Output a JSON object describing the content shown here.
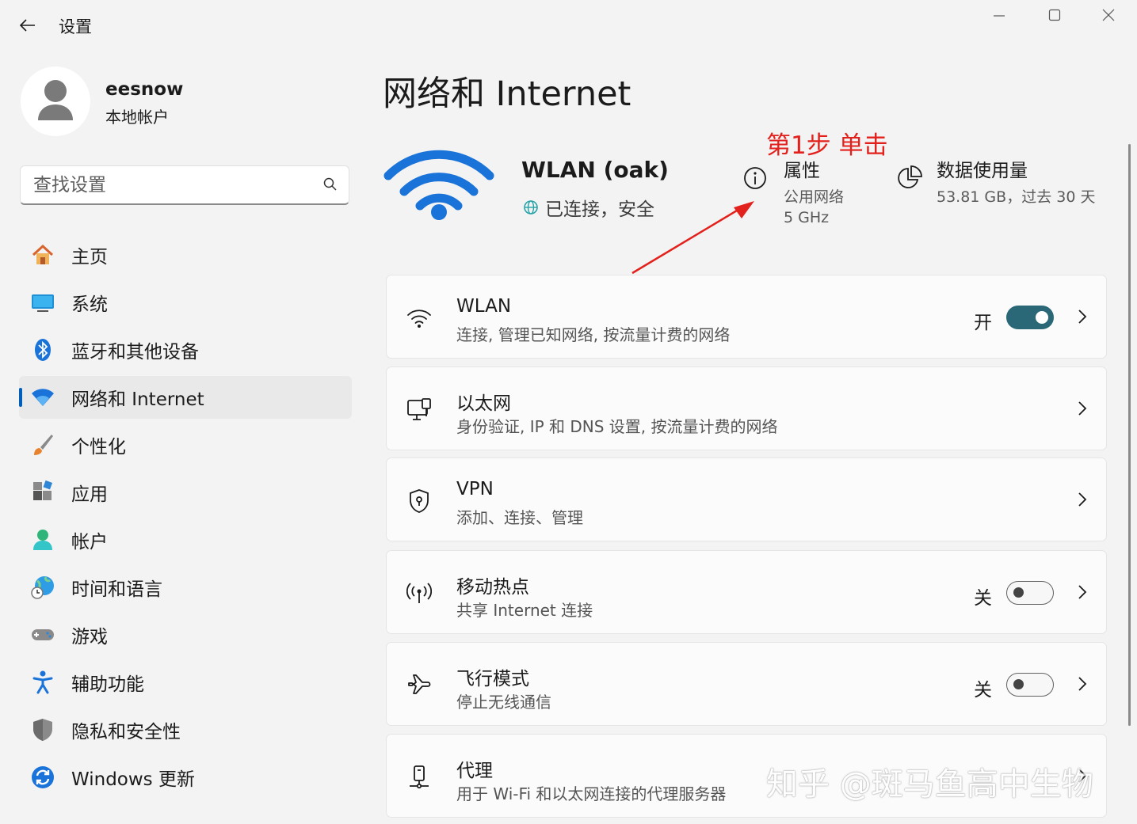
{
  "window": {
    "title": "设置",
    "controls": [
      "minimize-icon",
      "maximize-icon",
      "close-icon"
    ]
  },
  "profile": {
    "name": "eesnow",
    "account_type": "本地帐户"
  },
  "search": {
    "placeholder": "查找设置"
  },
  "nav": {
    "items": [
      {
        "label": "主页",
        "icon": "home-icon"
      },
      {
        "label": "系统",
        "icon": "monitor-icon"
      },
      {
        "label": "蓝牙和其他设备",
        "icon": "bluetooth-icon"
      },
      {
        "label": "网络和 Internet",
        "icon": "wifi-icon",
        "active": true
      },
      {
        "label": "个性化",
        "icon": "brush-icon"
      },
      {
        "label": "应用",
        "icon": "apps-icon"
      },
      {
        "label": "帐户",
        "icon": "person-icon"
      },
      {
        "label": "时间和语言",
        "icon": "globe-clock-icon"
      },
      {
        "label": "游戏",
        "icon": "gamepad-icon"
      },
      {
        "label": "辅助功能",
        "icon": "accessibility-icon"
      },
      {
        "label": "隐私和安全性",
        "icon": "shield-icon"
      },
      {
        "label": "Windows 更新",
        "icon": "update-icon"
      }
    ]
  },
  "main": {
    "title": "网络和 Internet",
    "network": {
      "name": "WLAN (oak)",
      "status": "已连接，安全"
    },
    "annotation": "第1步 单击",
    "properties": {
      "title": "属性",
      "line1": "公用网络",
      "line2": "5 GHz"
    },
    "data_usage": {
      "title": "数据使用量",
      "value": "53.81 GB，过去 30 天"
    },
    "cards": [
      {
        "title": "WLAN",
        "subtitle": "连接, 管理已知网络, 按流量计费的网络",
        "icon": "wifi-icon",
        "toggle_label": "开",
        "toggle_on": true
      },
      {
        "title": "以太网",
        "subtitle": "身份验证, IP 和 DNS 设置, 按流量计费的网络",
        "icon": "ethernet-icon"
      },
      {
        "title": "VPN",
        "subtitle": "添加、连接、管理",
        "icon": "vpn-shield-icon"
      },
      {
        "title": "移动热点",
        "subtitle": "共享 Internet 连接",
        "icon": "hotspot-icon",
        "toggle_label": "关",
        "toggle_on": false
      },
      {
        "title": "飞行模式",
        "subtitle": "停止无线通信",
        "icon": "airplane-icon",
        "toggle_label": "关",
        "toggle_on": false
      },
      {
        "title": "代理",
        "subtitle": "用于 Wi-Fi 和以太网连接的代理服务器",
        "icon": "proxy-icon"
      }
    ]
  },
  "watermark": "知乎 @斑马鱼高中生物",
  "colors": {
    "accent": "#005fb8",
    "wifi_blue": "#1a73d9",
    "toggle_on": "#2a6878",
    "annotation_red": "#e3211c"
  }
}
